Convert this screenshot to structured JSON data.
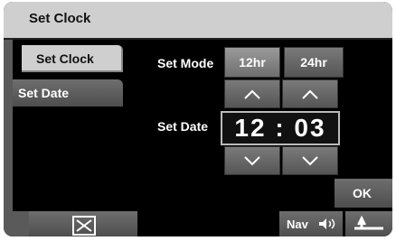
{
  "header": {
    "title": "Set Clock"
  },
  "tabs": [
    {
      "label": "Set Clock",
      "active": true
    },
    {
      "label": "Set Date",
      "active": false
    }
  ],
  "mode": {
    "label": "Set Mode",
    "options": [
      "12hr",
      "24hr"
    ],
    "selected": "12hr"
  },
  "time": {
    "label": "Set Date",
    "value": "12 : 03"
  },
  "buttons": {
    "ok": "OK",
    "nav": "Nav",
    "close_icon": "close-box-icon",
    "back_icon": "return-arrow-icon",
    "sound_icon": "speaker-icon"
  }
}
